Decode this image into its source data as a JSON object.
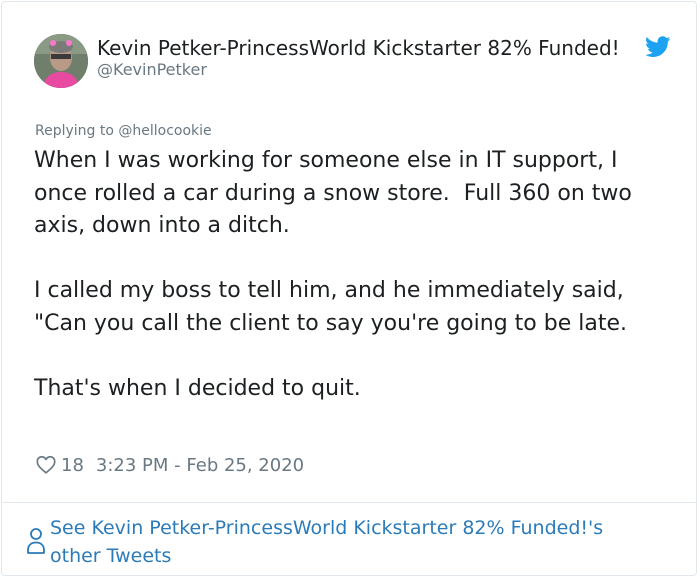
{
  "tweet": {
    "author": {
      "name": "Kevin Petker-PrincessWorld Kickstarter 82% Funded!",
      "handle": "@KevinPetker"
    },
    "reply": {
      "prefix": "Replying to ",
      "handle": "@hellocookie"
    },
    "text": "When I was working for someone else in IT support, I once rolled a car during a snow store.  Full 360 on two axis, down into a ditch.\n\nI called my boss to tell him, and he immediately said, \"Can you call the client to say you're going to be late.\n\nThat's when I decided to quit.",
    "likes": "18",
    "timestamp": "3:23 PM - Feb 25, 2020",
    "see_more": "See Kevin Petker-PrincessWorld Kickstarter 82% Funded!'s other Tweets"
  },
  "colors": {
    "text": "#1c2022",
    "muted": "#697882",
    "link": "#2b7bb9",
    "twitter_blue": "#1da1f2",
    "border": "#e1e8ed"
  },
  "icons": {
    "brand": "twitter-bird-icon",
    "like": "heart-icon",
    "profile": "person-icon"
  }
}
